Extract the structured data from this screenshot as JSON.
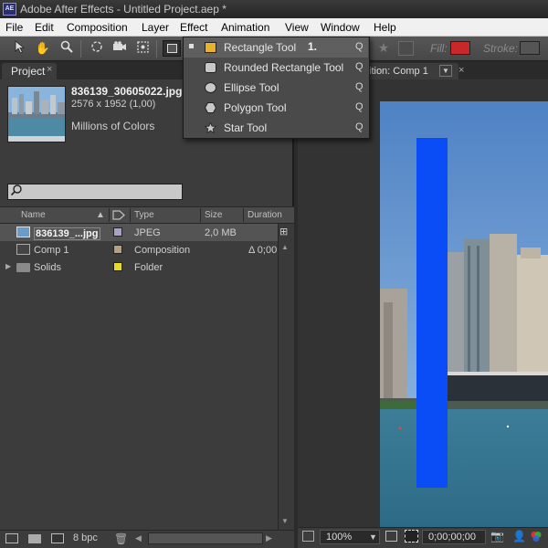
{
  "window": {
    "title": "Adobe After Effects - Untitled Project.aep *",
    "app_icon_text": "AE"
  },
  "menubar": {
    "items": [
      "File",
      "Edit",
      "Composition",
      "Layer",
      "Effect",
      "Animation",
      "View",
      "Window",
      "Help"
    ]
  },
  "toolbar": {
    "tools": [
      "selection-tool",
      "hand-tool",
      "zoom-tool",
      "rotation-tool",
      "camera-tool",
      "pan-behind-tool",
      "rectangle-tool"
    ],
    "fill_label": "Fill:",
    "fill_color": "#c8282a",
    "stroke_label": "Stroke:"
  },
  "shape_menu": {
    "items": [
      {
        "label": "Rectangle Tool",
        "shortcut": "Q",
        "icon": "rectangle-icon",
        "selected": true
      },
      {
        "label": "Rounded Rectangle Tool",
        "shortcut": "Q",
        "icon": "rounded-rectangle-icon"
      },
      {
        "label": "Ellipse Tool",
        "shortcut": "Q",
        "icon": "ellipse-icon"
      },
      {
        "label": "Polygon Tool",
        "shortcut": "Q",
        "icon": "polygon-icon"
      },
      {
        "label": "Star Tool",
        "shortcut": "Q",
        "icon": "star-icon"
      }
    ],
    "step_annotation": "1."
  },
  "project": {
    "tab_label": "Project",
    "tab_close": "×",
    "selected_file": {
      "name": "836139_30605022.jpg",
      "dimensions": "2576 x 1952 (1,00)",
      "colors": "Millions of Colors"
    },
    "columns": [
      "Name",
      "Type",
      "Size",
      "Duration"
    ],
    "items": [
      {
        "name": "836139_...jpg",
        "type": "JPEG",
        "size": "2,0 MB",
        "duration": "",
        "label_color": "#a9a2c8"
      },
      {
        "name": "Comp 1",
        "type": "Composition",
        "size": "",
        "duration": "Δ 0;00",
        "label_color": "#b1a283"
      },
      {
        "name": "Solids",
        "type": "Folder",
        "size": "",
        "duration": "",
        "label_color": "#e6d92a"
      }
    ],
    "bit_depth": "8 bpc"
  },
  "composition": {
    "tab_label": "ition: Comp 1",
    "tab_close": "×",
    "zoom": "100%",
    "timecode": "0;00;00;00",
    "shape_color": "#0a4cf6"
  }
}
